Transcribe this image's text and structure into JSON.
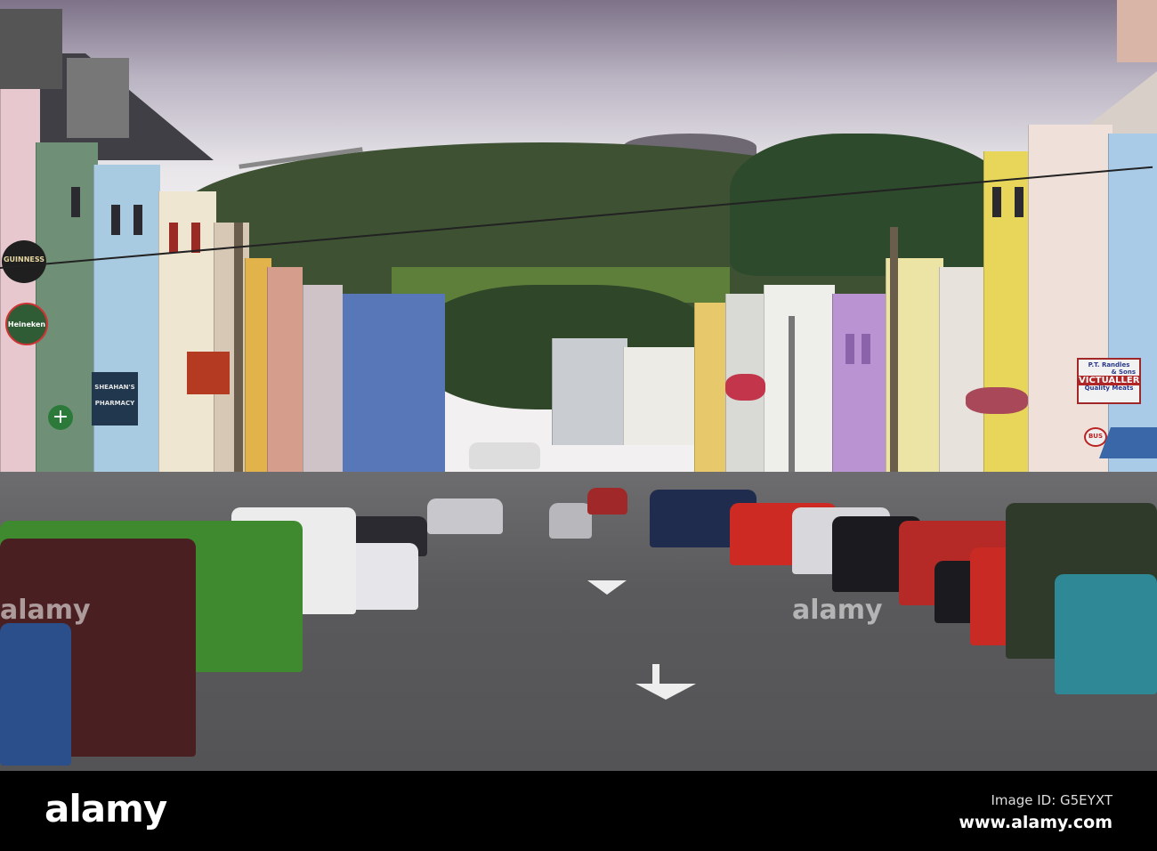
{
  "photo": {
    "subject": "street-scene",
    "signs": {
      "guinness": "GUINNESS",
      "heineken": "Heineken",
      "pharmacy_name": "SHEAHAN'S",
      "pharmacy_type": "PHARMACY",
      "randles_name": "P.T. Randles",
      "randles_sons": "& Sons",
      "victualler": "VICTUALLER",
      "quality_meats": "Quality Meats",
      "bus": "BUS"
    },
    "watermarks": [
      "alamy",
      "alamy"
    ]
  },
  "footer": {
    "logo": "alamy",
    "image_id": "Image ID: G5EYXT",
    "website": "www.alamy.com"
  },
  "colors": {
    "footer_bg": "#000000",
    "road": "#5a5a5c",
    "hill": "#3e5233"
  }
}
